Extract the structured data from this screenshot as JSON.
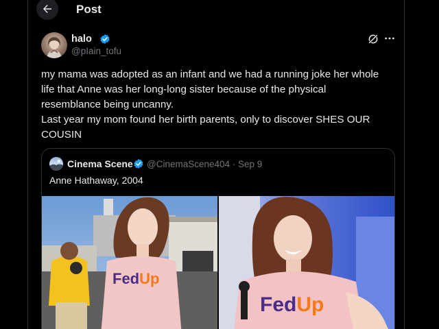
{
  "header": {
    "title": "Post"
  },
  "post": {
    "display_name": "halo",
    "handle": "@pIain_tofu",
    "text_lines": [
      "my mama was adopted as an infant and we had a running joke her whole",
      "life that Anne was her long-long sister because of the physical",
      "resemblance being uncanny.",
      "Last year my mom found her birth parents, only to discover SHES OUR",
      "COUSIN"
    ]
  },
  "quote": {
    "display_name": "Cinema Scene",
    "handle_date": "@CinemaScene404 · Sep 9",
    "text": "Anne Hathaway, 2004",
    "shirt_text": "FedUp"
  },
  "icons": {
    "back": "arrow-left-icon",
    "verified": "verified-badge-icon",
    "grok": "grok-icon",
    "more": "more-icon"
  },
  "colors": {
    "background": "#000000",
    "text": "#e7e9ea",
    "secondary": "#71767b",
    "verified": "#1d9bf0",
    "border": "#2f3336"
  }
}
